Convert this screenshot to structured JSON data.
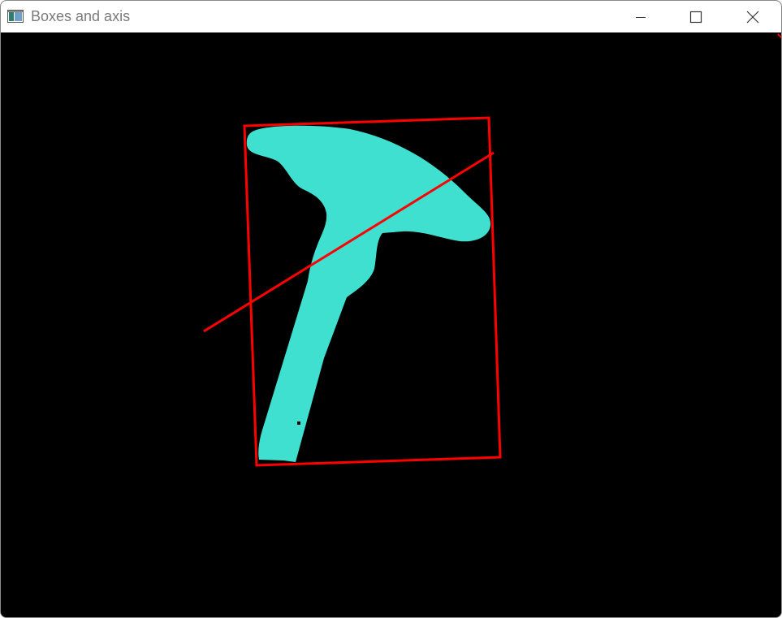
{
  "window": {
    "title": "Boxes and axis"
  },
  "icons": {
    "app": "app-window-icon",
    "minimize": "minimize-icon",
    "maximize": "maximize-icon",
    "close": "close-icon"
  },
  "colors": {
    "background": "#000000",
    "shape_fill": "#40E0D0",
    "box_and_axis": "#FF0000",
    "titlebar": "#FFFFFF",
    "title_text": "#7A7A7A"
  }
}
